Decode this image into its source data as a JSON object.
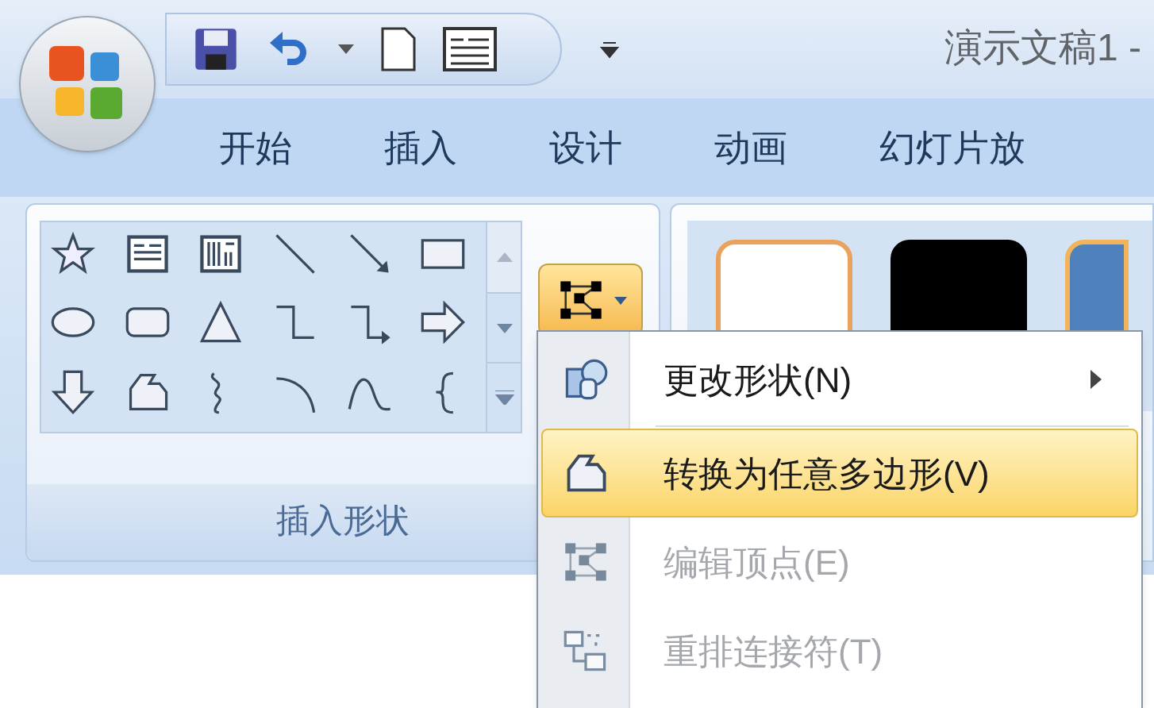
{
  "window": {
    "title": "演示文稿1 -"
  },
  "tabs": [
    {
      "label": "开始"
    },
    {
      "label": "插入"
    },
    {
      "label": "设计"
    },
    {
      "label": "动画"
    },
    {
      "label": "幻灯片放"
    }
  ],
  "ribbon": {
    "group_label": "插入形状"
  },
  "menu": {
    "items": [
      {
        "label": "更改形状(N)",
        "highlighted": false,
        "disabled": false,
        "submenu": true
      },
      {
        "label": "转换为任意多边形(V)",
        "highlighted": true,
        "disabled": false,
        "submenu": false
      },
      {
        "label": "编辑顶点(E)",
        "highlighted": false,
        "disabled": true,
        "submenu": false
      },
      {
        "label": "重排连接符(T)",
        "highlighted": false,
        "disabled": true,
        "submenu": false
      }
    ]
  }
}
